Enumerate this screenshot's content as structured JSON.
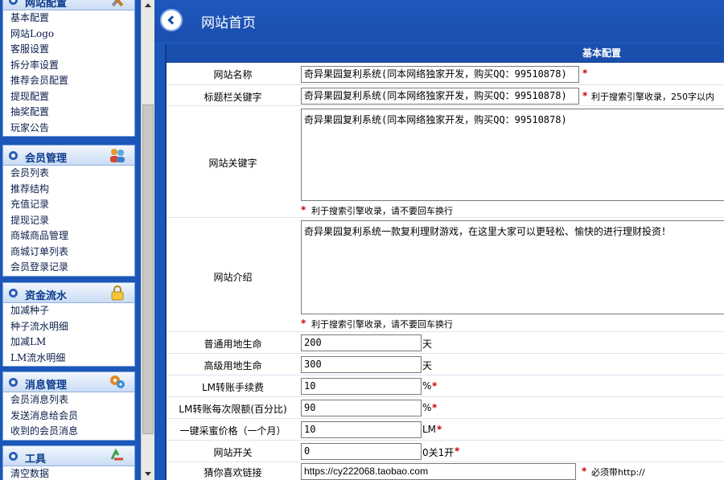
{
  "sidebar": {
    "groups": [
      {
        "title": "网站配置",
        "icon": "tools-icon",
        "items": [
          "基本配置",
          "网站Logo",
          "客服设置",
          "拆分率设置",
          "推荐会员配置",
          "提现配置",
          "抽奖配置",
          "玩家公告"
        ]
      },
      {
        "title": "会员管理",
        "icon": "users-icon",
        "items": [
          "会员列表",
          "推荐结构",
          "充值记录",
          "提现记录",
          "商城商品管理",
          "商城订单列表",
          "会员登录记录"
        ]
      },
      {
        "title": "资金流水",
        "icon": "lock-icon",
        "items": [
          "加减种子",
          "种子流水明细",
          "加减LM",
          "LM流水明细"
        ]
      },
      {
        "title": "消息管理",
        "icon": "gears-icon",
        "items": [
          "会员消息列表",
          "发送消息给会员",
          "收到的会员消息"
        ]
      },
      {
        "title": "工具",
        "icon": "recycle-icon",
        "items": [
          "清空数据"
        ]
      }
    ]
  },
  "header": {
    "title": "网站首页",
    "back_icon": "back-arrow-icon"
  },
  "panel": {
    "title": "基本配置"
  },
  "form": {
    "site_name": {
      "label": "网站名称",
      "value": "奇异果园复利系统(同本网络独家开发，购买QQ：99510878)",
      "star": "*"
    },
    "title_keywords": {
      "label": "标题栏关键字",
      "value": "奇异果园复利系统(同本网络独家开发，购买QQ：99510878)",
      "star": "*",
      "hint": "利于搜索引擎收录，250字以内"
    },
    "site_keywords": {
      "label": "网站关键字",
      "value": "奇异果园复利系统(同本网络独家开发，购买QQ：99510878)",
      "star": "*",
      "hint": "利于搜索引擎收录，请不要回车换行"
    },
    "site_intro": {
      "label": "网站介绍",
      "value": "奇异果园复利系统一款复利理财游戏，在这里大家可以更轻松、愉快的进行理财投资！",
      "star": "*",
      "hint": "利于搜索引擎收录，请不要回车换行"
    },
    "normal_land_life": {
      "label": "普通用地生命",
      "value": "200",
      "unit": "天"
    },
    "advanced_land_life": {
      "label": "高级用地生命",
      "value": "300",
      "unit": "天"
    },
    "lm_fee": {
      "label": "LM转账手续费",
      "value": "10",
      "unit": "%",
      "star": "*"
    },
    "lm_limit": {
      "label": "LM转账每次限额(百分比)",
      "value": "90",
      "unit": "%",
      "star": "*"
    },
    "honey_price": {
      "label": "一键采蜜价格（一个月）",
      "value": "10",
      "unit": "LM",
      "star": "*"
    },
    "site_switch": {
      "label": "网站开关",
      "value": "0",
      "unit": "0关1开",
      "star": "*"
    },
    "fav_link": {
      "label": "猜你喜欢链接",
      "value": "https://cy222068.taobao.com",
      "star": "*",
      "hint": "必须带http://"
    }
  },
  "colors": {
    "blue": "#1b56b8",
    "dark_blue": "#0f3a86",
    "star_red": "#cc0000"
  }
}
